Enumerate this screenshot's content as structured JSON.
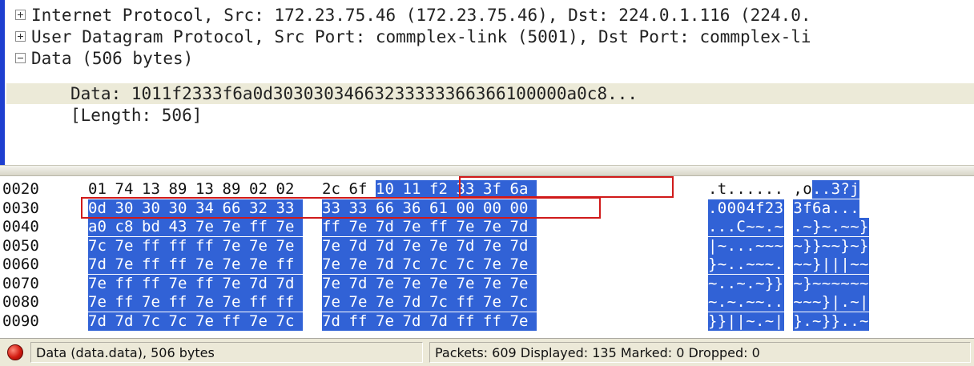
{
  "details": {
    "rows": [
      {
        "label": "Internet Protocol, Src: 172.23.75.46 (172.23.75.46), Dst: 224.0.1.116 (224.0."
      },
      {
        "label": "User Datagram Protocol, Src Port: commplex-link (5001), Dst Port: commplex-li"
      },
      {
        "label": "Data (506 bytes)"
      },
      {
        "label": "Data: 1011f2333f6a0d30303034663233333366366100000a0c8..."
      },
      {
        "label": "[Length: 506]"
      }
    ]
  },
  "hex": {
    "rows": [
      {
        "offset": "0020",
        "bytes": [
          "01",
          "74",
          "13",
          "89",
          "13",
          "89",
          "02",
          "02",
          "2c",
          "6f",
          "10",
          "11",
          "f2",
          "33",
          "3f",
          "6a"
        ],
        "ascii": ".t......,o..3?j"
      },
      {
        "offset": "0030",
        "bytes": [
          "0d",
          "30",
          "30",
          "30",
          "34",
          "66",
          "32",
          "33",
          "33",
          "33",
          "66",
          "36",
          "61",
          "00",
          "00",
          "00"
        ],
        "ascii": ".0004f23 3f6a..."
      },
      {
        "offset": "0040",
        "bytes": [
          "a0",
          "c8",
          "bd",
          "43",
          "7e",
          "7e",
          "ff",
          "7e",
          "ff",
          "7e",
          "7d",
          "7e",
          "ff",
          "7e",
          "7e",
          "7d"
        ],
        "ascii": "...C~~.~ .~}~.~~}"
      },
      {
        "offset": "0050",
        "bytes": [
          "7c",
          "7e",
          "ff",
          "ff",
          "ff",
          "7e",
          "7e",
          "7e",
          "7e",
          "7d",
          "7d",
          "7e",
          "7e",
          "7d",
          "7e",
          "7d"
        ],
        "ascii": "|~...~~~ ~}}~~}~}"
      },
      {
        "offset": "0060",
        "bytes": [
          "7d",
          "7e",
          "ff",
          "ff",
          "7e",
          "7e",
          "7e",
          "ff",
          "7e",
          "7e",
          "7d",
          "7c",
          "7c",
          "7c",
          "7e",
          "7e"
        ],
        "ascii": "}~..~~~. ~~}|||~~"
      },
      {
        "offset": "0070",
        "bytes": [
          "7e",
          "ff",
          "ff",
          "7e",
          "ff",
          "7e",
          "7d",
          "7d",
          "7e",
          "7d",
          "7e",
          "7e",
          "7e",
          "7e",
          "7e",
          "7e"
        ],
        "ascii": "~..~.~}} ~}~~~~~~"
      },
      {
        "offset": "0080",
        "bytes": [
          "7e",
          "ff",
          "7e",
          "ff",
          "7e",
          "7e",
          "ff",
          "ff",
          "7e",
          "7e",
          "7e",
          "7d",
          "7c",
          "ff",
          "7e",
          "7c"
        ],
        "ascii": "~.~.~~.. ~~~}|.~|"
      },
      {
        "offset": "0090",
        "bytes": [
          "7d",
          "7d",
          "7c",
          "7c",
          "7e",
          "ff",
          "7e",
          "7c",
          "7d",
          "ff",
          "7e",
          "7d",
          "7d",
          "ff",
          "ff",
          "7e"
        ],
        "ascii": "}}||~.~| }.~}}..~"
      }
    ]
  },
  "status": {
    "left": "Data (data.data), 506 bytes",
    "right": "Packets: 609 Displayed: 135 Marked: 0 Dropped: 0"
  },
  "colors": {
    "selection": "#3162d6",
    "annotation_box": "#d01a1a",
    "status_bg": "#ece9d8"
  }
}
